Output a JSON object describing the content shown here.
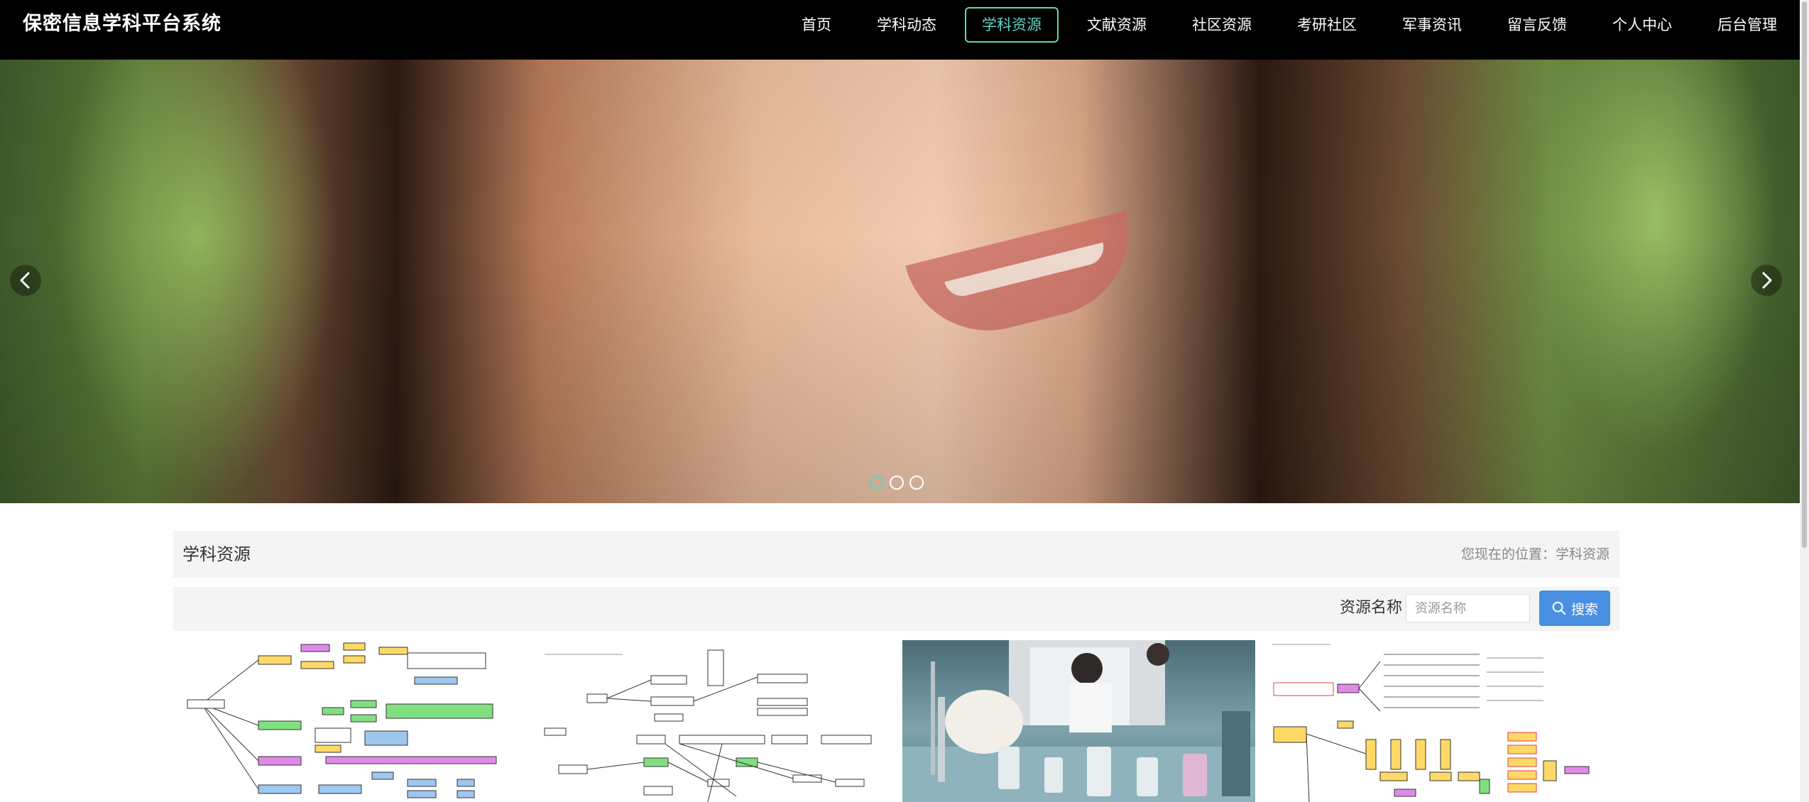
{
  "header": {
    "brand": "保密信息学科平台系统",
    "nav": [
      {
        "label": "首页"
      },
      {
        "label": "学科动态"
      },
      {
        "label": "学科资源",
        "active": true
      },
      {
        "label": "文献资源"
      },
      {
        "label": "社区资源"
      },
      {
        "label": "考研社区"
      },
      {
        "label": "军事资讯"
      },
      {
        "label": "留言反馈"
      },
      {
        "label": "个人中心"
      },
      {
        "label": "后台管理"
      }
    ]
  },
  "banner": {
    "prev_icon": "chevron-left-icon",
    "next_icon": "chevron-right-icon",
    "slide_count": 3,
    "active_slide": 1
  },
  "section": {
    "title": "学科资源",
    "breadcrumb": "您现在的位置：学科资源"
  },
  "search": {
    "label": "资源名称",
    "placeholder": "资源名称",
    "value": "",
    "button_label": "搜索",
    "button_icon": "search-icon"
  },
  "colors": {
    "topbar_bg": "#000000",
    "accent": "#5fd3c3",
    "search_button": "#4a90e2",
    "panel_bg": "#f4f4f4"
  }
}
